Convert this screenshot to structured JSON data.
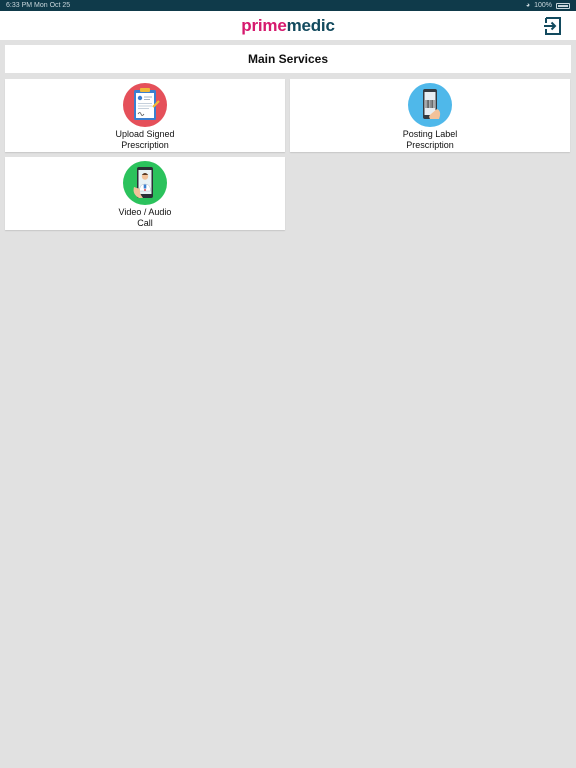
{
  "status_bar": {
    "time_date": "6:33 PM   Mon Oct 25",
    "battery": "100%"
  },
  "header": {
    "logo_prime": "prime",
    "logo_medic": "medic",
    "logout_icon": "logout-icon"
  },
  "main": {
    "title": "Main Services",
    "services": [
      {
        "line1": "Upload Signed",
        "line2": "Prescription",
        "icon": "prescription-clipboard-icon",
        "color": "#e5505a"
      },
      {
        "line1": "Posting Label",
        "line2": "Prescription",
        "icon": "phone-barcode-icon",
        "color": "#4fb8ea"
      },
      {
        "line1": "Video / Audio",
        "line2": "Call",
        "icon": "doctor-phone-icon",
        "color": "#2bc25c"
      }
    ]
  },
  "colors": {
    "brand_pink": "#d6196e",
    "brand_teal": "#124a5e",
    "status_bar_bg": "#0f3a4a",
    "page_bg": "#e1e1e1"
  }
}
